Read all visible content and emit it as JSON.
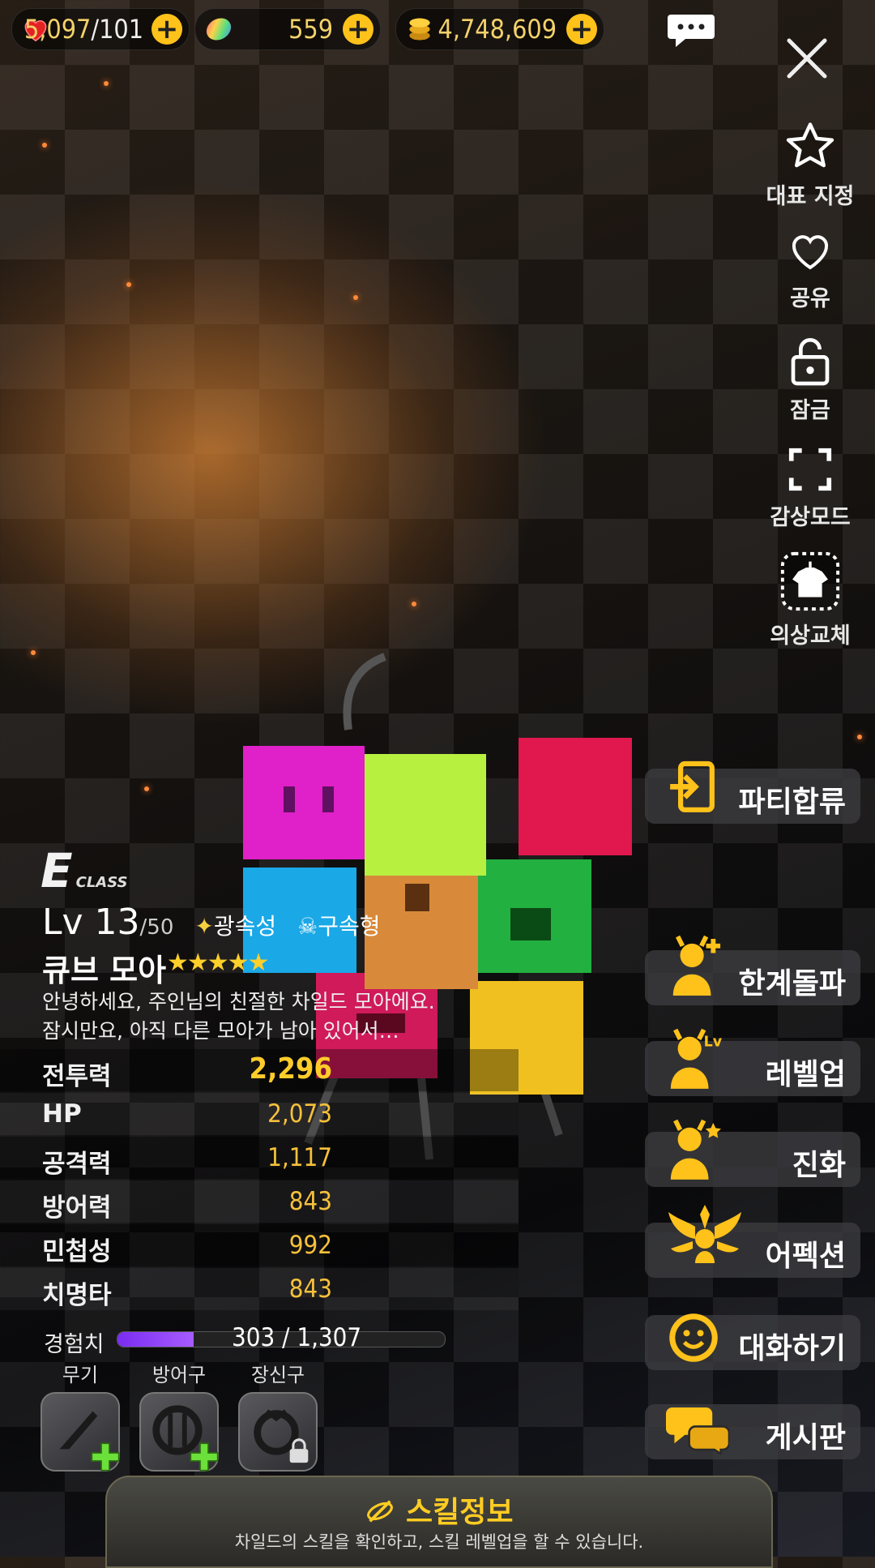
{
  "resources": {
    "stamina": {
      "value": "5,097",
      "max": "/101",
      "icon": "heart-icon"
    },
    "gems": {
      "value": "559",
      "icon": "rainbow-gem-icon"
    },
    "gold": {
      "value": "4,748,609",
      "icon": "gold-coin-icon"
    }
  },
  "sidebar": {
    "items": [
      {
        "label": "대표 지정",
        "icon": "star-icon"
      },
      {
        "label": "공유",
        "icon": "heart-outline-icon"
      },
      {
        "label": "잠금",
        "icon": "lock-icon"
      },
      {
        "label": "감상모드",
        "icon": "fullscreen-icon"
      },
      {
        "label": "의상교체",
        "icon": "costume-icon"
      }
    ]
  },
  "actions": [
    {
      "label": "파티합류",
      "icon": "enter-icon"
    },
    {
      "label": "한계돌파",
      "icon": "limit-break-icon"
    },
    {
      "label": "레벨업",
      "icon": "level-up-icon"
    },
    {
      "label": "진화",
      "icon": "evolve-icon"
    },
    {
      "label": "어펙션",
      "icon": "affection-icon"
    },
    {
      "label": "대화하기",
      "icon": "smile-icon"
    },
    {
      "label": "게시판",
      "icon": "board-icon"
    }
  ],
  "character": {
    "class_letter": "E",
    "class_word": "CLASS",
    "level": "Lv 13",
    "level_max": "/50",
    "element": "광속성",
    "type": "구속형",
    "name": "큐브 모아",
    "stars": "★★★★★",
    "greeting_line1": "안녕하세요, 주인님의 친절한 차일드 모아에요.",
    "greeting_line2": "잠시만요, 아직 다른 모아가 남아 있어서…"
  },
  "stats": [
    {
      "key": "전투력",
      "value": "2,296"
    },
    {
      "key": "HP",
      "value": "2,073"
    },
    {
      "key": "공격력",
      "value": "1,117"
    },
    {
      "key": "방어력",
      "value": "843"
    },
    {
      "key": "민첩성",
      "value": "992"
    },
    {
      "key": "치명타",
      "value": "843"
    }
  ],
  "experience": {
    "label": "경험치",
    "text": "303 / 1,307",
    "fraction": 0.232
  },
  "equipment": [
    {
      "label": "무기",
      "icon": "knife-icon"
    },
    {
      "label": "방어구",
      "icon": "shield-icon"
    },
    {
      "label": "장신구",
      "icon": "ring-icon"
    }
  ],
  "skill": {
    "title": "스킬정보",
    "subtitle": "차일드의 스킬을 확인하고, 스킬 레벨업을 할 수 있습니다."
  },
  "colors": {
    "accent": "#ffc21a",
    "stat_value": "#f6c13a",
    "exp_fill": "#8a3cf5"
  }
}
